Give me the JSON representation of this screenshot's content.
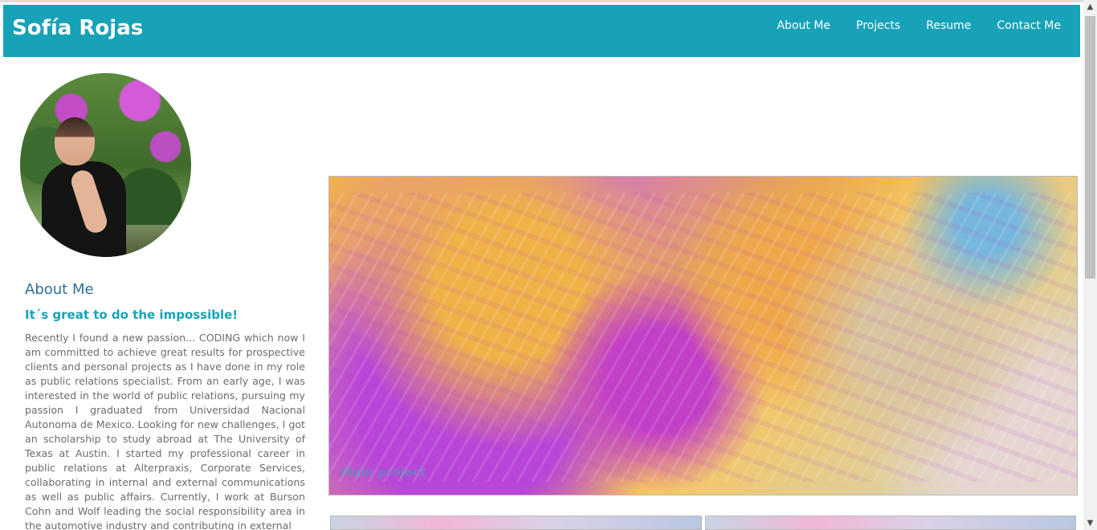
{
  "header": {
    "brand": "Sofía Rojas",
    "nav": [
      "About Me",
      "Projects",
      "Resume",
      "Contact Me"
    ]
  },
  "about": {
    "title": "About Me",
    "subtitle": "It´s great to do the impossible!",
    "text": "Recently I found a new passion... CODING which now I am committed to achieve great results for prospective clients and personal projects as I have done in my role as public relations specialist. From an early age, I was interested in the world of public relations, pursuing my passion I graduated from Universidad Nacional Autonoma de Mexico. Looking for new challenges, I got an scholarship to study abroad at The University of Texas at Austin. I started my professional career in public relations at Alterpraxis, Corporate Services, collaborating in internal and external communications as well as public affairs. Currently, I work at Burson Cohn and Wolf leading the social responsibility area in the automotive industry and contributing in external"
  },
  "projects": {
    "main_label": "Main project"
  },
  "colors": {
    "header_bg": "#17a2b8",
    "about_title": "#2f6f96",
    "subtitle": "#17a2b8"
  },
  "icons": {
    "scroll_up": "scroll-up-arrow-icon",
    "scroll_down": "scroll-down-arrow-icon"
  }
}
